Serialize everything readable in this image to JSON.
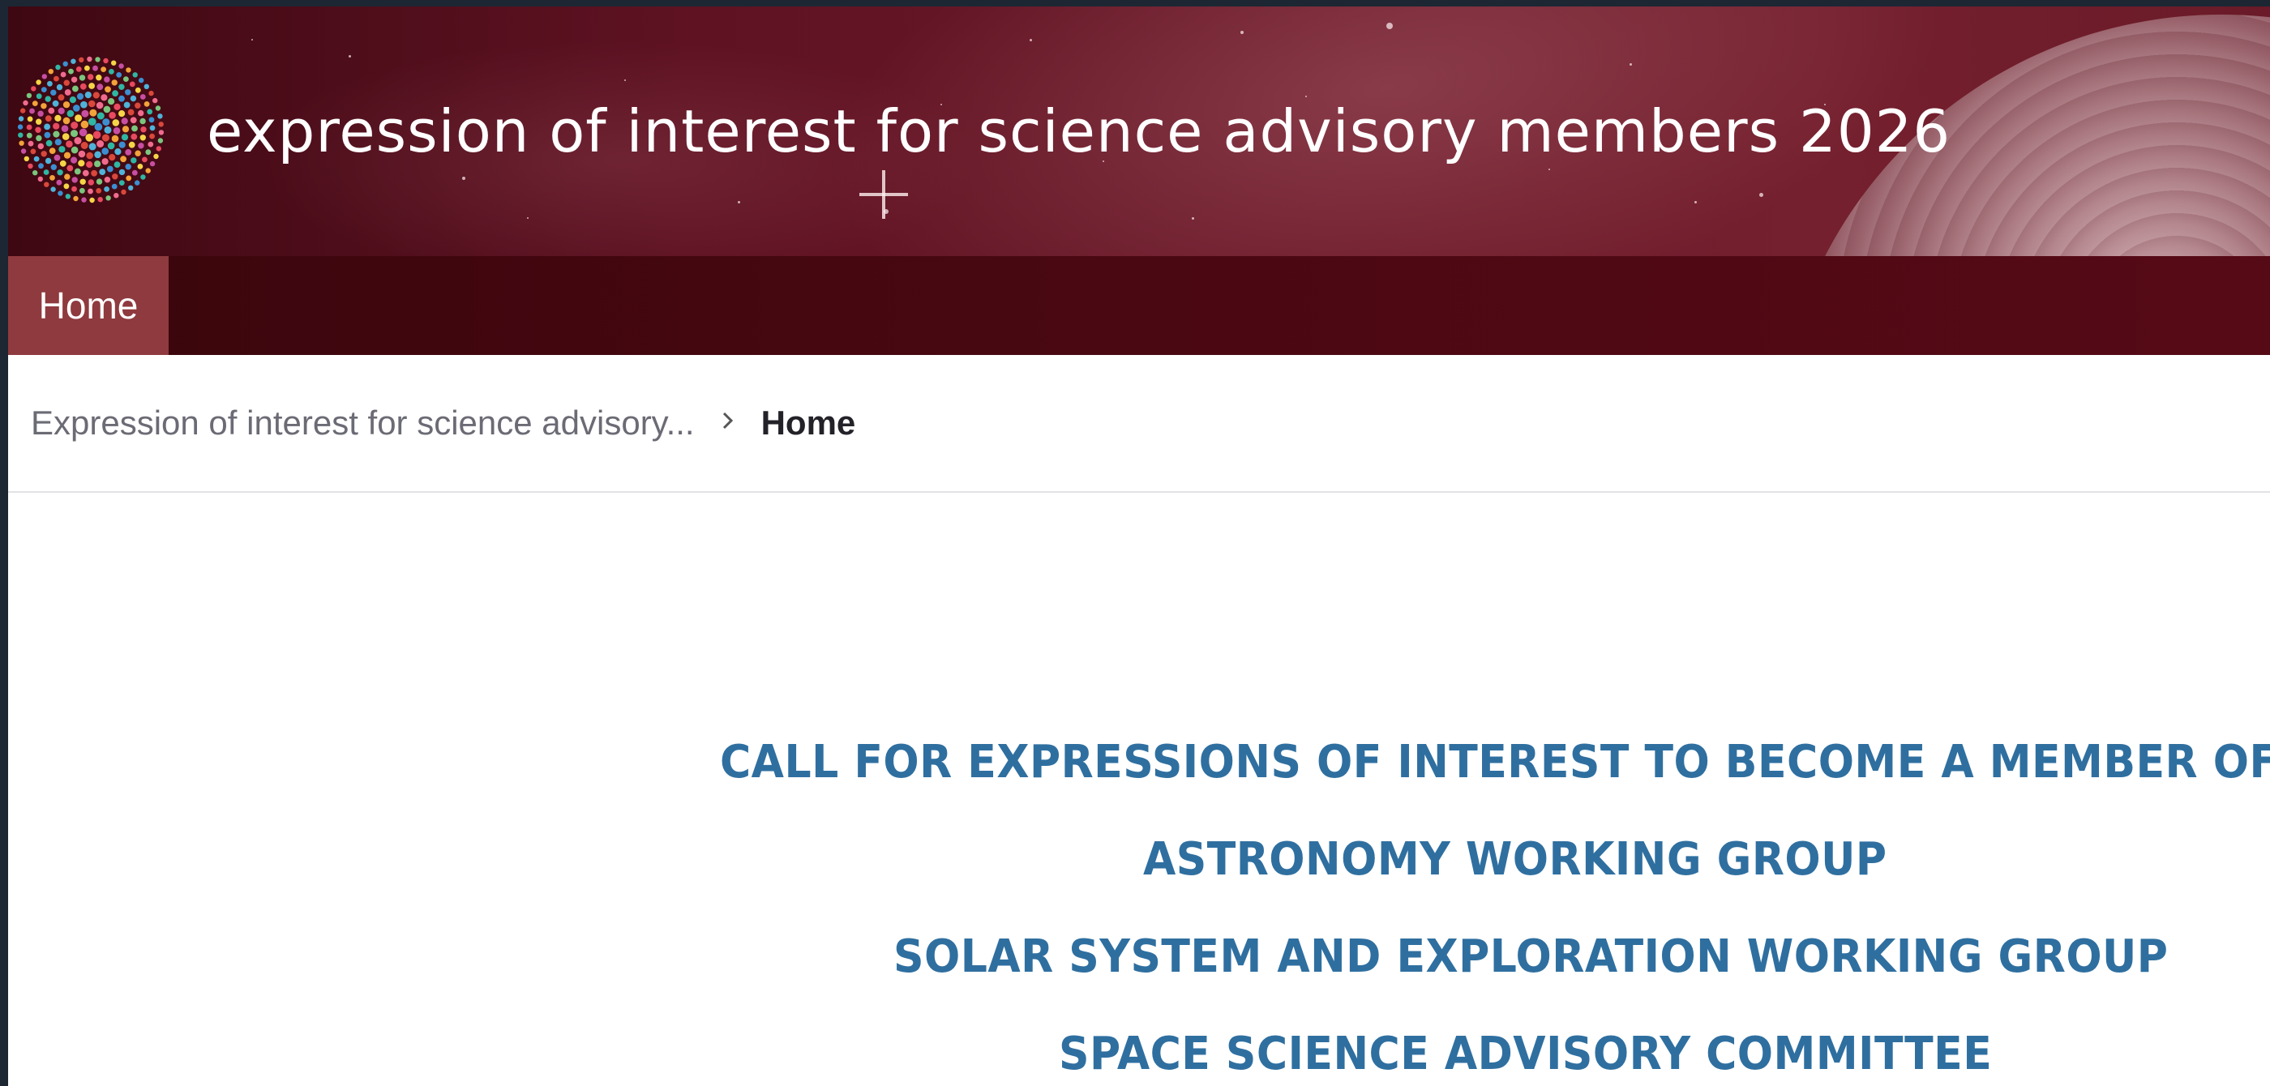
{
  "banner": {
    "title": "expression of interest for science advisory members 2026",
    "logo_icon": "dotted-globe-logo-icon"
  },
  "nav": {
    "items": [
      {
        "label": "Home",
        "active": true
      }
    ]
  },
  "breadcrumb": {
    "parent": "Expression of interest for science advisory...",
    "separator_icon": "chevron-right-icon",
    "current": "Home"
  },
  "content": {
    "headings": [
      "CALL FOR EXPRESSIONS OF INTEREST TO BECOME A MEMBER OF THE",
      "ASTRONOMY WORKING GROUP",
      "SOLAR SYSTEM AND EXPLORATION WORKING GROUP",
      "SPACE SCIENCE ADVISORY COMMITTEE"
    ]
  },
  "colors": {
    "banner": "#5e1222",
    "nav": "#4a0812",
    "nav_active": "#8f3a3e",
    "heading": "#2f6fa0"
  }
}
